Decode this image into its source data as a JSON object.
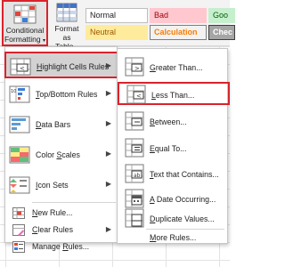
{
  "ribbon": {
    "conditional_formatting": {
      "line1": "Conditional",
      "line2": "Formatting"
    },
    "format_as_table": {
      "line1": "Format as",
      "line2": "Table"
    },
    "cell_styles": [
      {
        "label": "Normal",
        "kind": "normal"
      },
      {
        "label": "Bad",
        "kind": "bad"
      },
      {
        "label": "Goo",
        "kind": "good"
      },
      {
        "label": "Neutral",
        "kind": "neutral"
      },
      {
        "label": "Calculation",
        "kind": "calc"
      },
      {
        "label": "Chec",
        "kind": "check"
      }
    ]
  },
  "menu": {
    "items": [
      {
        "label": "Highlight Cells Rules",
        "underline": "H",
        "icon": "highlight-cells-icon",
        "has_submenu": true,
        "highlighted": true
      },
      {
        "label": "Top/Bottom Rules",
        "underline": "T",
        "icon": "top-bottom-icon",
        "has_submenu": true
      },
      {
        "label": "Data Bars",
        "underline": "D",
        "icon": "data-bars-icon",
        "has_submenu": true
      },
      {
        "label": "Color Scales",
        "underline": "S",
        "icon": "color-scales-icon",
        "has_submenu": true
      },
      {
        "label": "Icon Sets",
        "underline": "I",
        "icon": "icon-sets-icon",
        "has_submenu": true
      }
    ],
    "small_items": [
      {
        "label": "New Rule...",
        "underline": "N",
        "icon": "new-rule-icon"
      },
      {
        "label": "Clear Rules",
        "underline": "C",
        "icon": "clear-rules-icon",
        "has_submenu": true
      },
      {
        "label": "Manage Rules...",
        "underline": "R",
        "icon": "manage-rules-icon"
      }
    ]
  },
  "submenu": {
    "items": [
      {
        "label": "Greater Than...",
        "underline": "G",
        "icon": "greater-than-icon"
      },
      {
        "label": "Less Than...",
        "underline": "L",
        "icon": "less-than-icon",
        "highlighted": true
      },
      {
        "label": "Between...",
        "underline": "B",
        "icon": "between-icon"
      },
      {
        "label": "Equal To...",
        "underline": "E",
        "icon": "equal-to-icon"
      },
      {
        "label": "Text that Contains...",
        "underline": "T",
        "icon": "text-contains-icon"
      },
      {
        "label": "A Date Occurring...",
        "underline": "A",
        "icon": "date-occurring-icon"
      },
      {
        "label": "Duplicate Values...",
        "underline": "D",
        "icon": "duplicate-values-icon"
      }
    ],
    "more_rules": {
      "label": "More Rules...",
      "underline": "M"
    }
  },
  "colors": {
    "highlight_border": "#d9232b",
    "menu_hover": "#d2d2d2",
    "bad_fill": "#ffc7ce",
    "good_fill": "#c6efce",
    "neutral_fill": "#ffeb9c",
    "calc_text": "#fa7d00"
  }
}
